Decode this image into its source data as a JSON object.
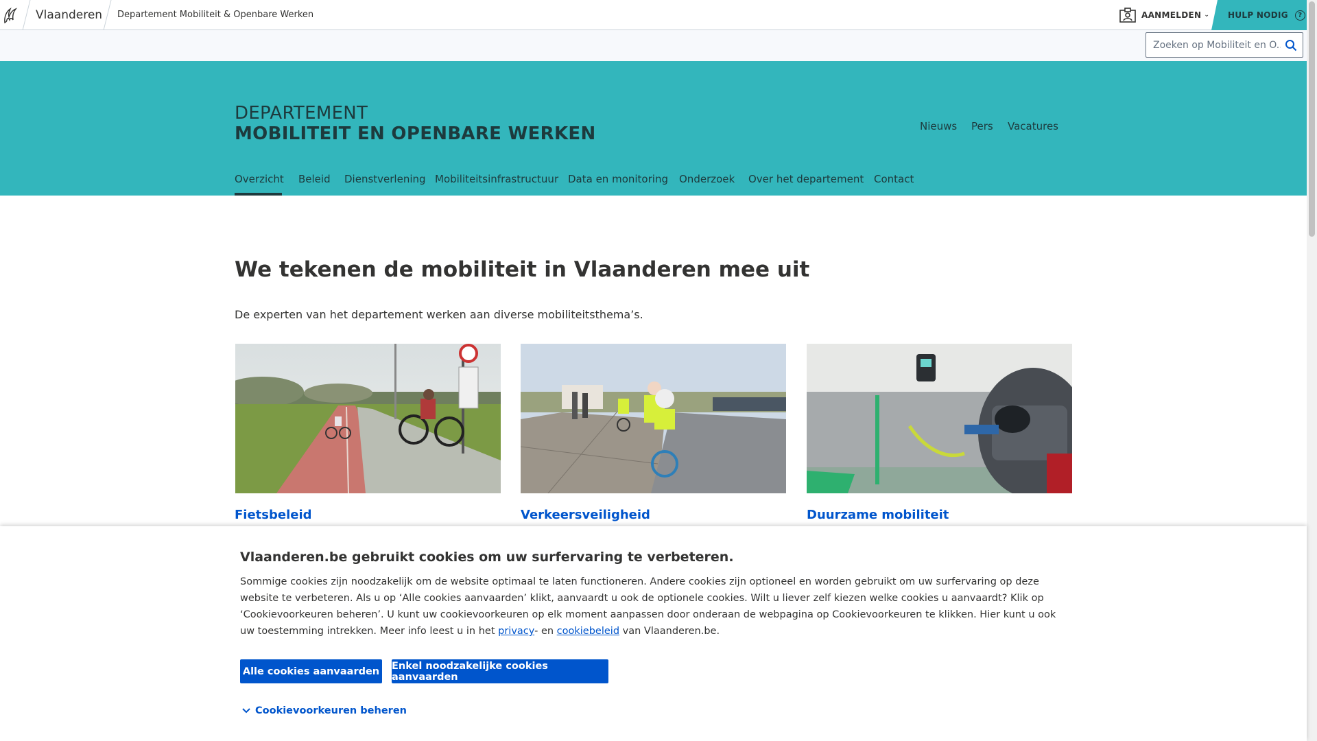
{
  "global_header": {
    "brand": "Vlaanderen",
    "department": "Departement Mobiliteit & Openbare Werken",
    "login_label": "AANMELDEN",
    "help_label": "HULP NODIG"
  },
  "search": {
    "placeholder": "Zoeken op Mobiliteit en O..."
  },
  "hero": {
    "title_line1": "DEPARTEMENT",
    "title_line2": "MOBILITEIT EN OPENBARE WERKEN",
    "top_links": [
      "Nieuws",
      "Pers",
      "Vacatures"
    ],
    "tabs": [
      "Overzicht",
      "Beleid",
      "Dienstverlening",
      "Mobiliteitsinfrastructuur",
      "Data en monitoring",
      "Onderzoek",
      "Over het departement",
      "Contact"
    ],
    "active_tab": "Overzicht"
  },
  "main": {
    "heading": "We tekenen de mobiliteit in Vlaanderen mee uit",
    "intro": "De experten van het departement werken aan diverse mobiliteitsthema’s.",
    "cards": [
      {
        "title": "Fietsbeleid"
      },
      {
        "title": "Verkeersveiligheid"
      },
      {
        "title": "Duurzame mobiliteit"
      }
    ]
  },
  "cookie_banner": {
    "title": "Vlaanderen.be gebruikt cookies om uw surfervaring te verbeteren.",
    "body_pre": "Sommige cookies zijn noodzakelijk om de website optimaal te laten functioneren. Andere cookies zijn optioneel en worden gebruikt om uw surfervaring op deze website te verbeteren. Als u op ‘Alle cookies aanvaarden’ klikt, aanvaardt u ook de optionele cookies. Wilt u liever zelf kiezen welke cookies u aanvaardt? Klik op ‘Cookievoorkeuren beheren’. U kunt uw cookievoorkeuren op elk moment aanpassen door onderaan de webpagina op Cookievoorkeuren te klikken. Hier kunt u ook uw toestemming intrekken. Meer info leest u in het ",
    "privacy_link": "privacy",
    "body_mid": "- en ",
    "cookiebeleid_link": "cookiebeleid",
    "body_post": " van Vlaanderen.be.",
    "accept_all_label": "Alle cookies aanvaarden",
    "accept_necessary_label": "Enkel noodzakelijke cookies aanvaarden",
    "preferences_label": "Cookievoorkeuren beheren"
  },
  "colors": {
    "hero_bg": "#33b6bc",
    "primary_blue": "#0055cc",
    "dark_text": "#1d3a3d"
  }
}
